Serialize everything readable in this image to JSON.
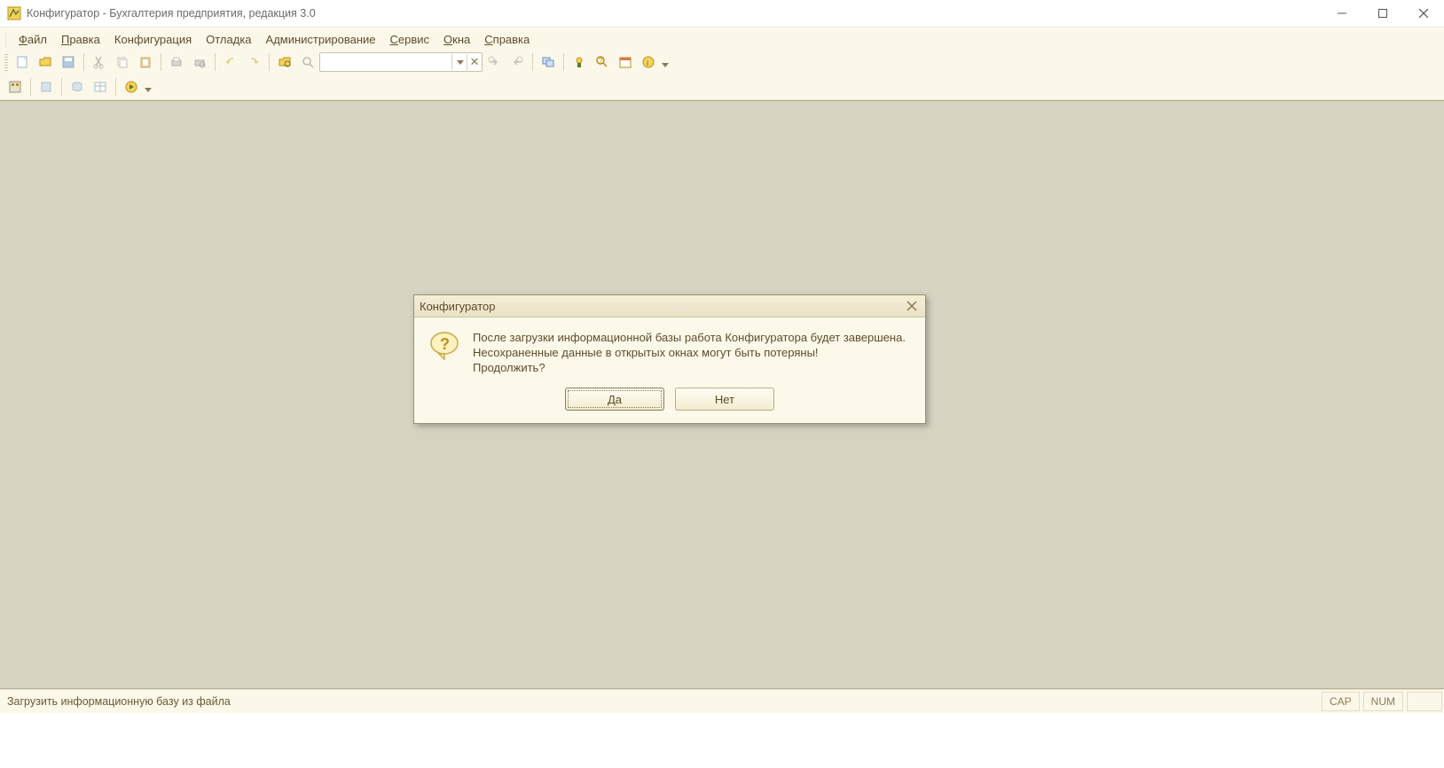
{
  "title": "Конфигуратор - Бухгалтерия предприятия, редакция 3.0",
  "menu": {
    "file": "Файл",
    "edit": "Правка",
    "config": "Конфигурация",
    "debug": "Отладка",
    "admin": "Администрирование",
    "service": "Сервис",
    "windows": "Окна",
    "help": "Справка"
  },
  "search": {
    "value": ""
  },
  "dialog": {
    "title": "Конфигуратор",
    "line1": "После загрузки информационной базы работа Конфигуратора будет завершена.",
    "line2": "Несохраненные данные в открытых окнах могут быть потеряны!",
    "line3": "Продолжить?",
    "yes": "Да",
    "no": "Нет"
  },
  "status": {
    "msg": "Загрузить информационную базу из файла",
    "cap": "CAP",
    "num": "NUM"
  }
}
